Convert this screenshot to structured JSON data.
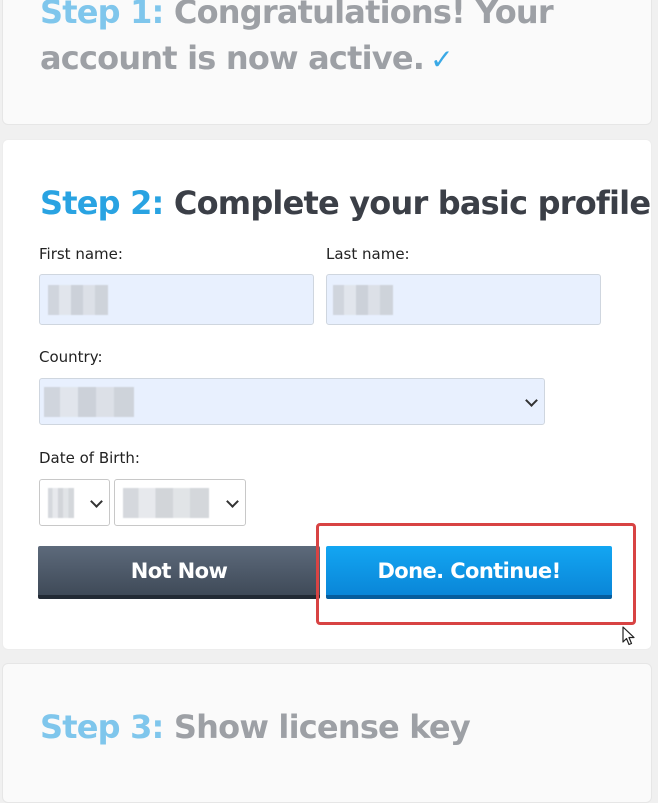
{
  "step1": {
    "num": "Step 1:",
    "text_line1": "Congratulations! Your",
    "text_line2": "account is now active.",
    "check": "✓"
  },
  "step2": {
    "num": "Step 2:",
    "text": "Complete your basic profile",
    "first_name_label": "First name:",
    "last_name_label": "Last name:",
    "country_label": "Country:",
    "dob_label": "Date of Birth:",
    "not_now": "Not Now",
    "done_continue": "Done. Continue!"
  },
  "step3": {
    "num": "Step 3:",
    "text": "Show license key"
  },
  "colors": {
    "accent": "#29a3e2",
    "primary_button": "#0a8fe0",
    "secondary_button": "#4a5666",
    "highlight": "#d84343"
  }
}
